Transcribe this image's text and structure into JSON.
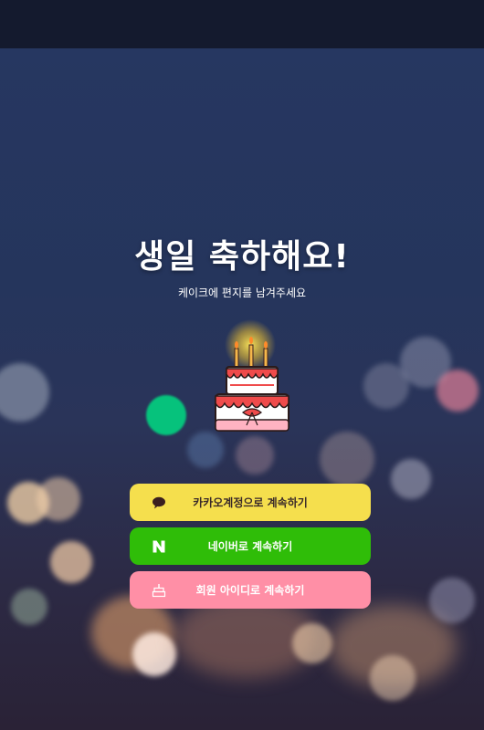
{
  "title": "생일 축하해요!",
  "subtitle": "케이크에 편지를 남겨주세요",
  "buttons": {
    "kakao": "카카오계정으로 계속하기",
    "naver": "네이버로 계속하기",
    "member": "회원 아이디로 계속하기"
  },
  "icons": {
    "kakao": "speech-bubble-icon",
    "naver": "naver-n-icon",
    "member": "cake-icon"
  },
  "colors": {
    "kakao": "#f5df4d",
    "naver": "#2fbd08",
    "member": "#ff8fa6",
    "background": "#25355c"
  }
}
